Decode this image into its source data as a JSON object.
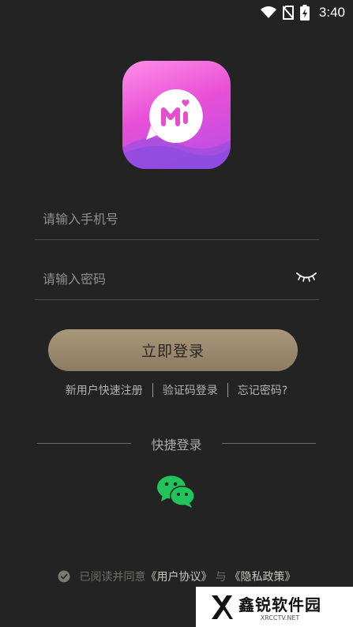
{
  "status_bar": {
    "time": "3:40",
    "icons": [
      "wifi-icon",
      "no-sim-icon",
      "battery-charging-icon"
    ]
  },
  "logo": {
    "icon": "app-logo-m-heart"
  },
  "form": {
    "phone_placeholder": "请输入手机号",
    "password_placeholder": "请输入密码",
    "password_toggle_icon": "eye-closed-icon"
  },
  "login_button": "立即登录",
  "links": {
    "register": "新用户快速注册",
    "sms_login": "验证码登录",
    "forgot": "忘记密码?"
  },
  "quick_login": {
    "label": "快捷登录",
    "icon": "wechat-icon",
    "color": "#21c35b"
  },
  "agreement": {
    "prefix": "已阅读并同意",
    "user_agreement": "《用户协议》",
    "and": "与",
    "privacy_policy": "《隐私政策》"
  },
  "watermark": {
    "title": "鑫锐软件园",
    "subtitle": "XRCCTV.NET"
  },
  "colors": {
    "background": "#222322",
    "button": "#9b8a6f",
    "logo_gradient": [
      "#ff8ee8",
      "#b24ee8"
    ]
  }
}
